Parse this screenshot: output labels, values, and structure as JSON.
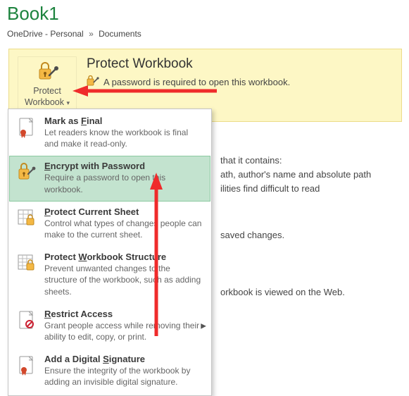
{
  "title": "Book1",
  "breadcrumb": {
    "root": "OneDrive - Personal",
    "folder": "Documents"
  },
  "protect": {
    "button_line1": "Protect",
    "button_line2": "Workbook",
    "heading": "Protect Workbook",
    "status": "A password is required to open this workbook."
  },
  "bg": {
    "a1": "that it contains:",
    "a2": "ath, author's name and absolute path",
    "a3": "ilities find difficult to read",
    "b1": "saved changes.",
    "c1": "orkbook is viewed on the Web."
  },
  "menu": [
    {
      "label": "Mark as Final",
      "accel": "F",
      "desc": "Let readers know the workbook is final and make it read-only."
    },
    {
      "label": "Encrypt with Password",
      "accel": "E",
      "desc": "Require a password to open this workbook."
    },
    {
      "label": "Protect Current Sheet",
      "accel": "P",
      "desc": "Control what types of changes people can make to the current sheet."
    },
    {
      "label": "Protect Workbook Structure",
      "accel": "W",
      "desc": "Prevent unwanted changes to the structure of the workbook, such as adding sheets."
    },
    {
      "label": "Restrict Access",
      "accel": "R",
      "desc": "Grant people access while removing their ability to edit, copy, or print."
    },
    {
      "label": "Add a Digital Signature",
      "accel": "S",
      "desc": "Ensure the integrity of the workbook by adding an invisible digital signature."
    }
  ]
}
